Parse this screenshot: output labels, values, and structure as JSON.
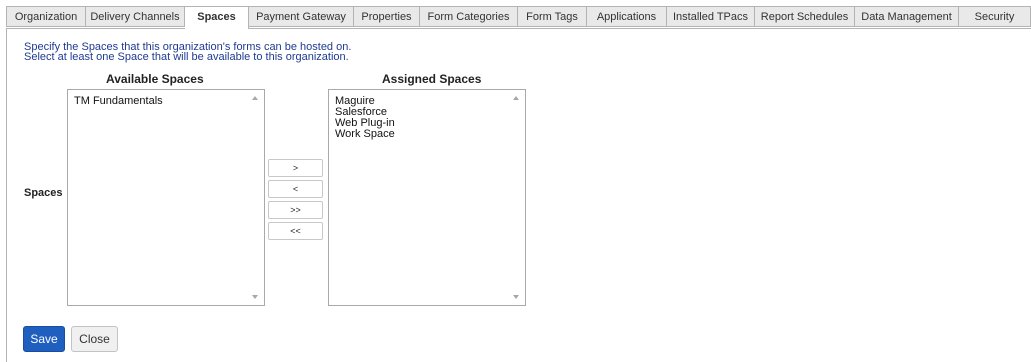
{
  "tabs": [
    {
      "label": "Organization"
    },
    {
      "label": "Delivery Channels"
    },
    {
      "label": "Spaces"
    },
    {
      "label": "Payment Gateway"
    },
    {
      "label": "Properties"
    },
    {
      "label": "Form Categories"
    },
    {
      "label": "Form Tags"
    },
    {
      "label": "Applications"
    },
    {
      "label": "Installed TPacs"
    },
    {
      "label": "Report Schedules"
    },
    {
      "label": "Data Management"
    },
    {
      "label": "Security"
    }
  ],
  "active_tab": "Spaces",
  "description": {
    "line1": "Specify the Spaces that this organization's forms can be hosted on.",
    "line2": "Select at least one Space that will be available to this organization."
  },
  "available": {
    "heading": "Available Spaces",
    "items": [
      "TM Fundamentals"
    ]
  },
  "assigned": {
    "heading": "Assigned Spaces",
    "items": [
      "Maguire",
      "Salesforce",
      "Web Plug-in",
      "Work Space"
    ]
  },
  "row_label": "Spaces",
  "move_buttons": {
    "add": ">",
    "remove": "<",
    "add_all": ">>",
    "remove_all": "<<"
  },
  "actions": {
    "save": "Save",
    "close": "Close"
  },
  "colors": {
    "primary": "#1f5fbf",
    "description_text": "#1f3a93"
  }
}
